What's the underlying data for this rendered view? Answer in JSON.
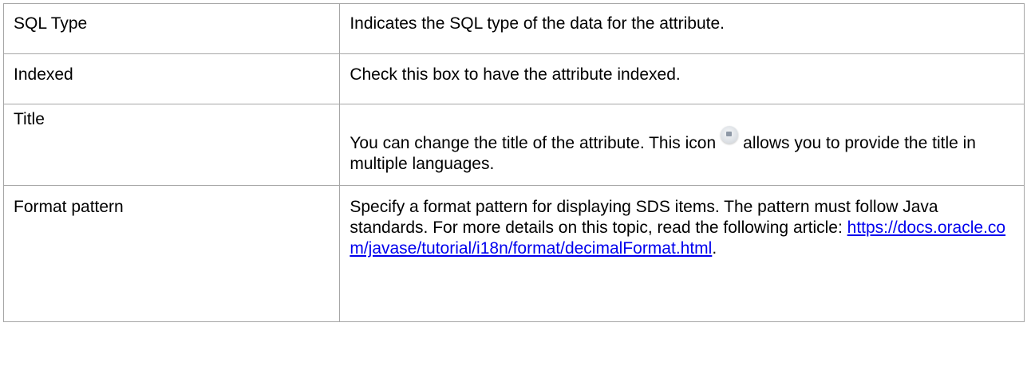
{
  "rows": [
    {
      "name": "SQL Type",
      "description": "Indicates the SQL type of the data for the attribute."
    },
    {
      "name": "Indexed",
      "description": "Check this box to have the attribute indexed."
    },
    {
      "name": "Title",
      "description_before_icon": "You can change the title of the attribute. This icon",
      "icon": "translate-language-icon",
      "description_after_icon": "allows you to provide the title in multiple languages."
    },
    {
      "name": "Format pattern",
      "description": "Specify a format pattern for displaying SDS items. The pattern must follow Java standards. For more details on this topic, read the following article:",
      "link_text": "https://docs.oracle.com/javase/tutorial/i18n/format/decimalFormat.html",
      "link_suffix": "."
    }
  ],
  "colors": {
    "border": "#a6a6a6",
    "link": "#0000ee",
    "text": "#000000"
  }
}
